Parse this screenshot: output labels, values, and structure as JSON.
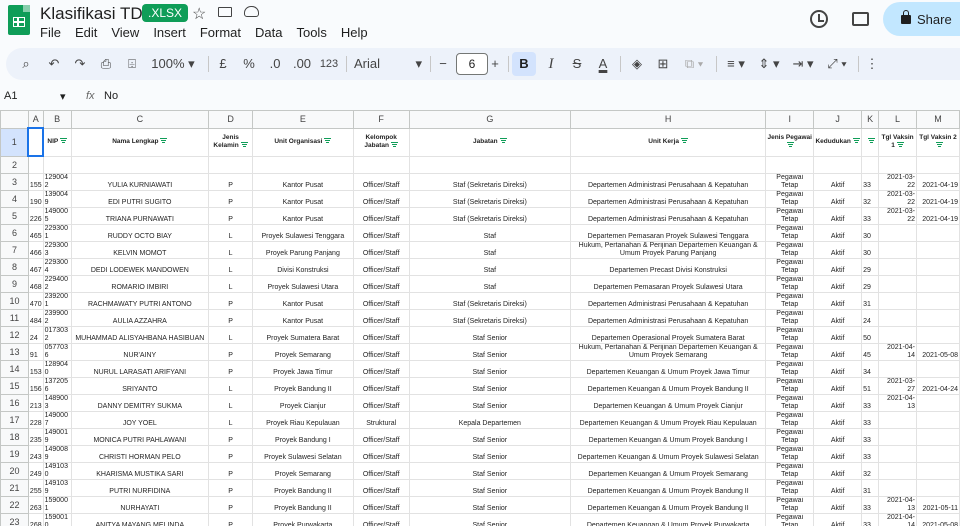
{
  "app": {
    "doc_title": "Klasifikasi TDP",
    "file_badge": ".XLSX",
    "share_label": "Share"
  },
  "menu": [
    "File",
    "Edit",
    "View",
    "Insert",
    "Format",
    "Data",
    "Tools",
    "Help"
  ],
  "toolbar": {
    "zoom": "100%",
    "currency": "£",
    "percent": "%",
    "dec_dec": ".0",
    "inc_dec": ".00",
    "number_format": "123",
    "font": "Arial",
    "font_size": "6",
    "bold": "B",
    "italic": "I",
    "strike": "S",
    "text_color": "A"
  },
  "formula_bar": {
    "cell_ref": "A1",
    "fx": "fx",
    "value": "No"
  },
  "columns": [
    "A",
    "B",
    "C",
    "D",
    "E",
    "F",
    "G",
    "H",
    "I",
    "J",
    "K",
    "L",
    "M"
  ],
  "header_row": [
    "",
    "NIP",
    "Nama Lengkap",
    "Jenis Kelamin",
    "Unit Organisasi",
    "Kelompok Jabatan",
    "Jabatan",
    "Unit Kerja",
    "Jenis Pegawai",
    "Kedudukan",
    "",
    "Tgl Vaksin 1",
    "Tgl Vaksin 2"
  ],
  "rows": [
    {
      "n": "155",
      "nip": "1290042",
      "nama": "YULIA KURNIAWATI",
      "jk": "P",
      "unit": "Kantor Pusat",
      "kel": "Officer/Staff",
      "jab": "Staf (Sekretaris Direksi)",
      "uk": "Departemen Administrasi Perusahaan & Kepatuhan",
      "jp": "Pegawai Tetap",
      "ked": "Aktif",
      "k": "33",
      "v1": "2021-03-22",
      "v2": "2021-04-19"
    },
    {
      "n": "190",
      "nip": "1390049",
      "nama": "EDI PUTRI SUGITO",
      "jk": "P",
      "unit": "Kantor Pusat",
      "kel": "Officer/Staff",
      "jab": "Staf (Sekretaris Direksi)",
      "uk": "Departemen Administrasi Perusahaan & Kepatuhan",
      "jp": "Pegawai Tetap",
      "ked": "Aktif",
      "k": "32",
      "v1": "2021-03-22",
      "v2": "2021-04-19"
    },
    {
      "n": "226",
      "nip": "1490005",
      "nama": "TRIANA PURNAWATI",
      "jk": "P",
      "unit": "Kantor Pusat",
      "kel": "Officer/Staff",
      "jab": "Staf (Sekretaris Direksi)",
      "uk": "Departemen Administrasi Perusahaan & Kepatuhan",
      "jp": "Pegawai Tetap",
      "ked": "Aktif",
      "k": "33",
      "v1": "2021-03-22",
      "v2": "2021-04-19"
    },
    {
      "n": "465",
      "nip": "2293001",
      "nama": "RUDDY OCTO BIAY",
      "jk": "L",
      "unit": "Proyek Sulawesi Tenggara",
      "kel": "Officer/Staff",
      "jab": "Staf",
      "uk": "Departemen Pemasaran Proyek Sulawesi Tenggara",
      "jp": "Pegawai Tetap",
      "ked": "Aktif",
      "k": "30",
      "v1": "",
      "v2": ""
    },
    {
      "n": "466",
      "nip": "2293003",
      "nama": "KELVIN MOMOT",
      "jk": "L",
      "unit": "Proyek Parung Panjang",
      "kel": "Officer/Staff",
      "jab": "Staf",
      "uk": "Hukum, Pertanahan & Perijinan Departemen Keuangan & Umum Proyek Parung Panjang",
      "jp": "Pegawai Tetap",
      "ked": "Aktif",
      "k": "30",
      "v1": "",
      "v2": ""
    },
    {
      "n": "467",
      "nip": "2293004",
      "nama": "DEDI LODEWEK MANDOWEN",
      "jk": "L",
      "unit": "Divisi Konstruksi",
      "kel": "Officer/Staff",
      "jab": "Staf",
      "uk": "Departemen Precast Divisi Konstruksi",
      "jp": "Pegawai Tetap",
      "ked": "Aktif",
      "k": "29",
      "v1": "",
      "v2": ""
    },
    {
      "n": "468",
      "nip": "2294002",
      "nama": "ROMARIO IMBIRI",
      "jk": "L",
      "unit": "Proyek Sulawesi Utara",
      "kel": "Officer/Staff",
      "jab": "Staf",
      "uk": "Departemen Pemasaran Proyek Sulawesi Utara",
      "jp": "Pegawai Tetap",
      "ked": "Aktif",
      "k": "29",
      "v1": "",
      "v2": ""
    },
    {
      "n": "470",
      "nip": "2392001",
      "nama": "RACHMAWATY PUTRI ANTONO",
      "jk": "P",
      "unit": "Kantor Pusat",
      "kel": "Officer/Staff",
      "jab": "Staf (Sekretaris Direksi)",
      "uk": "Departemen Administrasi Perusahaan & Kepatuhan",
      "jp": "Pegawai Tetap",
      "ked": "Aktif",
      "k": "31",
      "v1": "",
      "v2": ""
    },
    {
      "n": "484",
      "nip": "2399002",
      "nama": "AULIA AZZAHRA",
      "jk": "P",
      "unit": "Kantor Pusat",
      "kel": "Officer/Staff",
      "jab": "Staf (Sekretaris Direksi)",
      "uk": "Departemen Administrasi Perusahaan & Kepatuhan",
      "jp": "Pegawai Tetap",
      "ked": "Aktif",
      "k": "24",
      "v1": "",
      "v2": ""
    },
    {
      "n": "24",
      "nip": "0173032",
      "nama": "MUHAMMAD ALISYAHBANA HASIBUAN",
      "jk": "L",
      "unit": "Proyek Sumatera Barat",
      "kel": "Officer/Staff",
      "jab": "Staf Senior",
      "uk": "Departemen Operasional Proyek Sumatera Barat",
      "jp": "Pegawai Tetap",
      "ked": "Aktif",
      "k": "50",
      "v1": "",
      "v2": ""
    },
    {
      "n": "91",
      "nip": "0577036",
      "nama": "NUR'AINY",
      "jk": "P",
      "unit": "Proyek Semarang",
      "kel": "Officer/Staff",
      "jab": "Staf Senior",
      "uk": "Hukum, Pertanahan & Perijinan Departemen Keuangan & Umum Proyek Semarang",
      "jp": "Pegawai Tetap",
      "ked": "Aktif",
      "k": "45",
      "v1": "2021-04-14",
      "v2": "2021-05-08"
    },
    {
      "n": "153",
      "nip": "1289040",
      "nama": "NURUL LARASATI ARIFYANI",
      "jk": "P",
      "unit": "Proyek Jawa Timur",
      "kel": "Officer/Staff",
      "jab": "Staf Senior",
      "uk": "Departemen Keuangan & Umum Proyek Jawa Timur",
      "jp": "Pegawai Tetap",
      "ked": "Aktif",
      "k": "34",
      "v1": "",
      "v2": ""
    },
    {
      "n": "156",
      "nip": "1372056",
      "nama": "SRIYANTO",
      "jk": "L",
      "unit": "Proyek Bandung II",
      "kel": "Officer/Staff",
      "jab": "Staf Senior",
      "uk": "Departemen Keuangan & Umum Proyek Bandung II",
      "jp": "Pegawai Tetap",
      "ked": "Aktif",
      "k": "51",
      "v1": "2021-03-27",
      "v2": "2021-04-24"
    },
    {
      "n": "213",
      "nip": "1489003",
      "nama": "DANNY DEMITRY SUKMA",
      "jk": "L",
      "unit": "Proyek Cianjur",
      "kel": "Officer/Staff",
      "jab": "Staf Senior",
      "uk": "Departemen Keuangan & Umum Proyek Cianjur",
      "jp": "Pegawai Tetap",
      "ked": "Aktif",
      "k": "33",
      "v1": "2021-04-13",
      "v2": ""
    },
    {
      "n": "228",
      "nip": "1490007",
      "nama": "JOY YOEL",
      "jk": "L",
      "unit": "Proyek Riau Kepulauan",
      "kel": "Struktural",
      "jab": "Kepala Departemen",
      "uk": "Departemen Keuangan & Umum Proyek Riau Kepulauan",
      "jp": "Pegawai Tetap",
      "ked": "Aktif",
      "k": "33",
      "v1": "",
      "v2": ""
    },
    {
      "n": "235",
      "nip": "1490019",
      "nama": "MONICA PUTRI PAHLAWANI",
      "jk": "P",
      "unit": "Proyek Bandung I",
      "kel": "Officer/Staff",
      "jab": "Staf Senior",
      "uk": "Departemen Keuangan & Umum Proyek Bandung I",
      "jp": "Pegawai Tetap",
      "ked": "Aktif",
      "k": "33",
      "v1": "",
      "v2": ""
    },
    {
      "n": "243",
      "nip": "1490089",
      "nama": "CHRISTI HORMAN PELO",
      "jk": "P",
      "unit": "Proyek Sulawesi Selatan",
      "kel": "Officer/Staff",
      "jab": "Staf Senior",
      "uk": "Departemen Keuangan & Umum Proyek Sulawesi Selatan",
      "jp": "Pegawai Tetap",
      "ked": "Aktif",
      "k": "33",
      "v1": "",
      "v2": ""
    },
    {
      "n": "249",
      "nip": "1491030",
      "nama": "KHARISMA MUSTIKA SARI",
      "jk": "P",
      "unit": "Proyek Semarang",
      "kel": "Officer/Staff",
      "jab": "Staf Senior",
      "uk": "Departemen Keuangan & Umum Proyek Semarang",
      "jp": "Pegawai Tetap",
      "ked": "Aktif",
      "k": "32",
      "v1": "",
      "v2": ""
    },
    {
      "n": "255",
      "nip": "1491039",
      "nama": "PUTRI NURFIDINA",
      "jk": "P",
      "unit": "Proyek Bandung II",
      "kel": "Officer/Staff",
      "jab": "Staf Senior",
      "uk": "Departemen Keuangan & Umum Proyek Bandung II",
      "jp": "Pegawai Tetap",
      "ked": "Aktif",
      "k": "31",
      "v1": "",
      "v2": ""
    },
    {
      "n": "263",
      "nip": "1590001",
      "nama": "NURHAYATI",
      "jk": "P",
      "unit": "Proyek Bandung II",
      "kel": "Officer/Staff",
      "jab": "Staf Senior",
      "uk": "Departemen Keuangan & Umum Proyek Bandung II",
      "jp": "Pegawai Tetap",
      "ked": "Aktif",
      "k": "33",
      "v1": "2021-04-13",
      "v2": "2021-05-11"
    },
    {
      "n": "268",
      "nip": "1590010",
      "nama": "ANITYA MAYANG MELINDA",
      "jk": "P",
      "unit": "Proyek Purwakarta",
      "kel": "Officer/Staff",
      "jab": "Staf Senior",
      "uk": "Departemen Keuangan & Umum Proyek Purwakarta",
      "jp": "Pegawai Tetap",
      "ked": "Aktif",
      "k": "33",
      "v1": "2021-04-14",
      "v2": "2021-05-08"
    }
  ]
}
